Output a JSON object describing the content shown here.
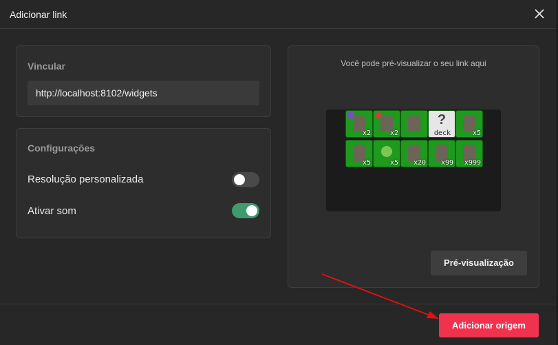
{
  "dialog": {
    "title": "Adicionar link",
    "close_icon": "close-icon"
  },
  "link_panel": {
    "title": "Vincular",
    "url_value": "http://localhost:8102/widgets"
  },
  "settings_panel": {
    "title": "Configurações",
    "items": [
      {
        "label": "Resolução personalizada",
        "enabled": false
      },
      {
        "label": "Ativar som",
        "enabled": true
      }
    ]
  },
  "preview_panel": {
    "hint": "Você pode pré-visualizar o seu link aqui",
    "tiles_row1": [
      {
        "count": "x2",
        "badge": "purple"
      },
      {
        "count": "x2",
        "badge": "heart"
      },
      {
        "count": ""
      },
      {
        "count": "deck",
        "card": true
      },
      {
        "count": "x5"
      }
    ],
    "tiles_row2": [
      {
        "count": "x5"
      },
      {
        "count": "x5"
      },
      {
        "count": "x20"
      },
      {
        "count": "x99"
      },
      {
        "count": "x999"
      }
    ],
    "preview_button": "Pré-visualização"
  },
  "footer": {
    "add_button": "Adicionar origem"
  },
  "colors": {
    "accent": "#f0324f",
    "toggle_on": "#3f9a6e",
    "annotation_arrow": "#e01010"
  }
}
